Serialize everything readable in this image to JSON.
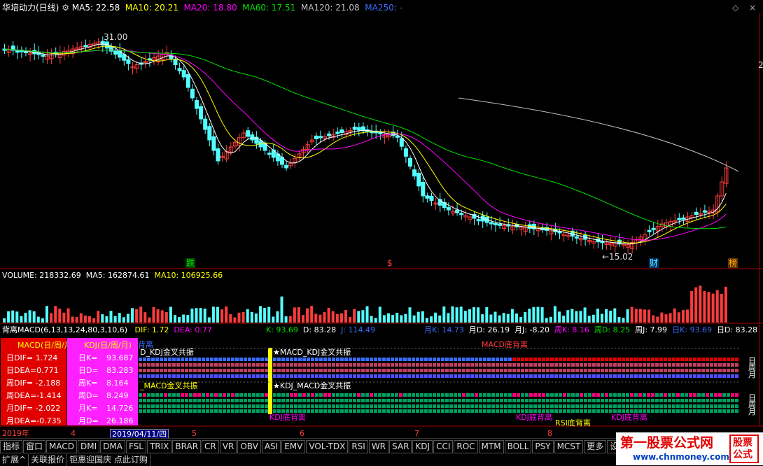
{
  "header": {
    "title": "华培动力(日线)",
    "ma5": "MA5: 22.58",
    "ma10": "MA10: 20.21",
    "ma20": "MA20: 18.80",
    "ma60": "MA60: 17.51",
    "ma120": "MA120: 21.08",
    "ma250": "MA250: -"
  },
  "annotations": {
    "high": "31.00",
    "low": "←15.02",
    "marker_die": "跌",
    "marker_dollar": "$",
    "marker_cai": "财",
    "marker_bang": "榜",
    "right_edge": "2"
  },
  "volume_header": {
    "volume": "VOLUME: 218332.69",
    "ma5": "MA5: 162874.61",
    "ma10": "MA10: 106925.66"
  },
  "indicator_header": {
    "name": "背离MACD(6,13,13,24,80,3,10,6)",
    "dif": "DIF: 1.72",
    "dea": "DEA: 0.77",
    "k": "K: 93.69",
    "d": "D: 83.28",
    "j": "J: 114.49",
    "mk": "月K: 14.73",
    "md": "月D: 26.19",
    "mj": "月J: -8.20",
    "wk": "周K: 8.16",
    "wd": "周D: 8.25",
    "wj": "周J: 7.99",
    "dk": "日K: 93.69",
    "dd": "日D: 83.28"
  },
  "macd_box": {
    "title": "MACD(日/周/月)",
    "rows": [
      "日DIF= 1.724",
      "日DEA=0.771",
      "周DIF= -2.188",
      "周DEA=-1.414",
      "月DIF= -2.022",
      "月DEA=-0.735"
    ]
  },
  "kdj_box": {
    "title": "KDJ(日/周/月)",
    "rows": [
      {
        "label": "日K=",
        "value": "93.687"
      },
      {
        "label": "日D=",
        "value": "83.283"
      },
      {
        "label": "周K=",
        "value": "8.164"
      },
      {
        "label": "周D=",
        "value": "8.249"
      },
      {
        "label": "月K=",
        "value": "14.726"
      },
      {
        "label": "月D=",
        "value": "26.186"
      }
    ]
  },
  "signals": {
    "macd_kdj_top": "D_KDJ金叉共振",
    "macd_kdj_star": "★MACD_KDJ金叉共振",
    "macd_bottom_div": "MACD底背离",
    "macd_gold": "_MACD金叉共振",
    "kdj_macd_star": "★KDJ_MACD金叉共振",
    "kdj_div1": "KDJ底背离",
    "kdj_div2": "KDJ底背离",
    "rsi_div": "RSI底背离",
    "kdj_div3": "KDJ底背离",
    "bei": "背离",
    "side_ri": "日",
    "side_zhou": "周",
    "side_yue": "月"
  },
  "timeline": {
    "year": "2019年",
    "m4": "4",
    "cursor_date": "2019/04/11/四",
    "m5": "5",
    "m6": "6",
    "m7": "7",
    "m8": "8"
  },
  "toolbar": [
    "指标",
    "窗口",
    "MACD",
    "DMI",
    "DMA",
    "FSL",
    "TRIX",
    "BRAR",
    "CR",
    "VR",
    "OBV",
    "ASI",
    "EMV",
    "VOL-TDX",
    "RSI",
    "WR",
    "SAR",
    "KDJ",
    "CCI",
    "ROC",
    "MTM",
    "BOLL",
    "PSY",
    "MCST",
    "更多",
    "设置"
  ],
  "toolbar2": [
    "扩展^",
    "关联报价",
    "钜惠迎国庆 点此订购"
  ],
  "brand": {
    "main": "第一股票公式网",
    "url": "www.chnmoney.com",
    "side1": "股票",
    "side2": "公式"
  },
  "colors": {
    "up": "#ff3c3c",
    "down": "#54ffff",
    "ma5": "#ffffff",
    "ma10": "#ffff00",
    "ma20": "#ff00ff",
    "ma60": "#00e000",
    "ma120": "#c0c0c0",
    "ma250": "#3a6cff"
  }
}
